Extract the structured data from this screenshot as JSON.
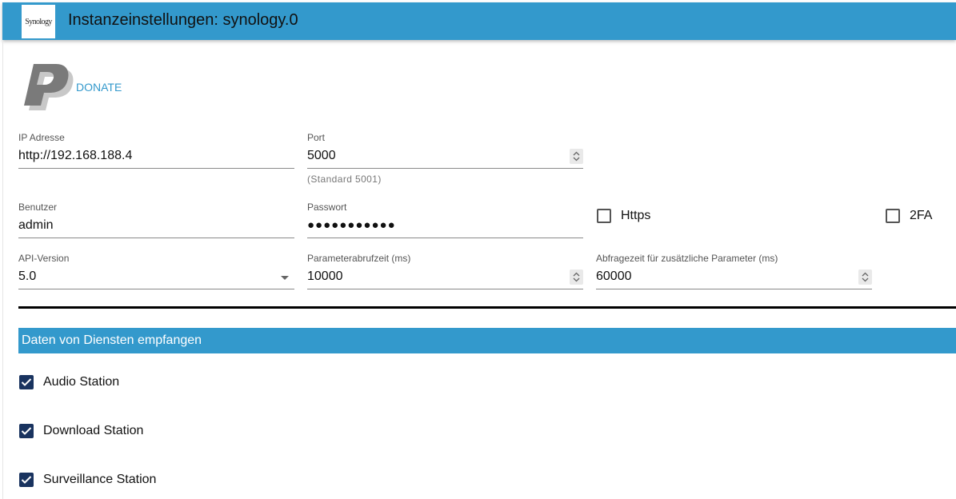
{
  "header": {
    "logo_text": "Synology",
    "title": "Instanzeinstellungen: synology.0"
  },
  "donate": {
    "label": "DONATE"
  },
  "fields": {
    "ip": {
      "label": "IP Adresse",
      "value": "http://192.168.188.4"
    },
    "port": {
      "label": "Port",
      "value": "5000",
      "helper": "(Standard 5001)"
    },
    "user": {
      "label": "Benutzer",
      "value": "admin"
    },
    "password": {
      "label": "Passwort",
      "value": "●●●●●●●●●●●"
    },
    "api": {
      "label": "API-Version",
      "value": "5.0"
    },
    "poll": {
      "label": "Parameterabrufzeit (ms)",
      "value": "10000"
    },
    "extra_poll": {
      "label": "Abfragezeit für zusätzliche Parameter (ms)",
      "value": "60000"
    }
  },
  "options": {
    "https": {
      "label": "Https",
      "checked": false
    },
    "twofa": {
      "label": "2FA",
      "checked": false
    }
  },
  "section": {
    "title": "Daten von Diensten empfangen",
    "services": [
      {
        "label": "Audio Station",
        "checked": true
      },
      {
        "label": "Download Station",
        "checked": true
      },
      {
        "label": "Surveillance Station",
        "checked": true
      }
    ]
  }
}
